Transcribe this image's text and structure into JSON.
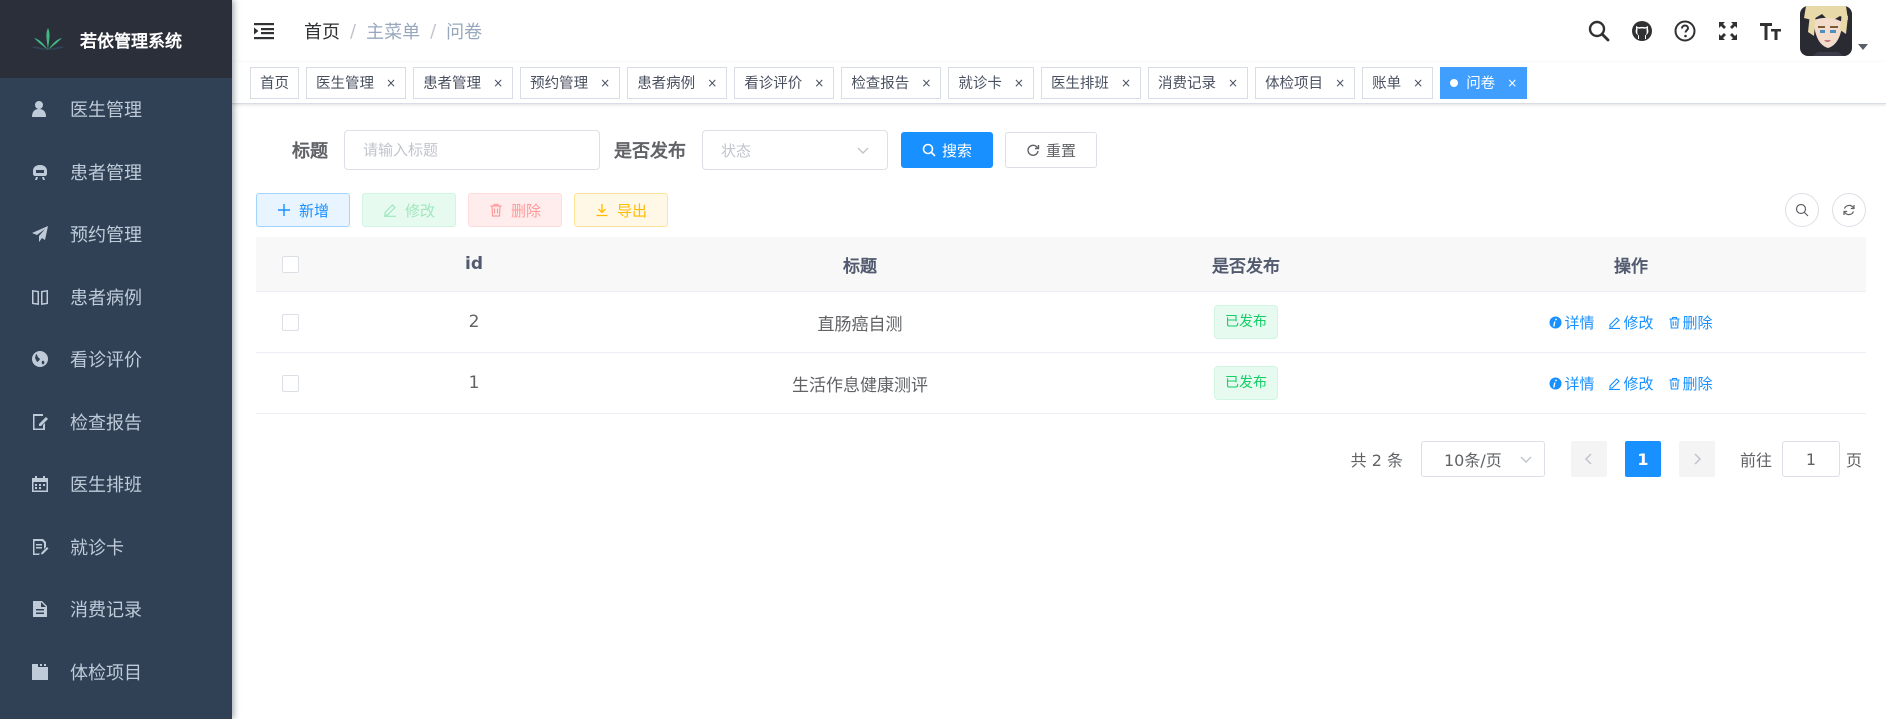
{
  "app": {
    "title": "若依管理系统"
  },
  "sidebar": {
    "items": [
      {
        "label": "医生管理",
        "icon": "doctor-icon"
      },
      {
        "label": "患者管理",
        "icon": "patient-icon"
      },
      {
        "label": "预约管理",
        "icon": "send-icon"
      },
      {
        "label": "患者病例",
        "icon": "book-icon"
      },
      {
        "label": "看诊评价",
        "icon": "globe-icon"
      },
      {
        "label": "检查报告",
        "icon": "edit-doc-icon"
      },
      {
        "label": "医生排班",
        "icon": "calendar-icon"
      },
      {
        "label": "就诊卡",
        "icon": "card-icon"
      },
      {
        "label": "消费记录",
        "icon": "receipt-icon"
      },
      {
        "label": "体检项目",
        "icon": "folder-icon"
      }
    ]
  },
  "breadcrumb": {
    "home": "首页",
    "menu": "主菜单",
    "current": "问卷",
    "separator": "/"
  },
  "tags": [
    {
      "label": "首页",
      "closable": false
    },
    {
      "label": "医生管理",
      "closable": true
    },
    {
      "label": "患者管理",
      "closable": true
    },
    {
      "label": "预约管理",
      "closable": true
    },
    {
      "label": "患者病例",
      "closable": true
    },
    {
      "label": "看诊评价",
      "closable": true
    },
    {
      "label": "检查报告",
      "closable": true
    },
    {
      "label": "就诊卡",
      "closable": true
    },
    {
      "label": "医生排班",
      "closable": true
    },
    {
      "label": "消费记录",
      "closable": true
    },
    {
      "label": "体检项目",
      "closable": true
    },
    {
      "label": "账单",
      "closable": true
    },
    {
      "label": "问卷",
      "closable": true,
      "active": true
    }
  ],
  "tag_close": "×",
  "search": {
    "title_label": "标题",
    "title_placeholder": "请输入标题",
    "title_value": "",
    "publish_label": "是否发布",
    "publish_placeholder": "状态",
    "search_button": "搜索",
    "reset_button": "重置"
  },
  "toolbar": {
    "add": "新增",
    "edit": "修改",
    "delete": "删除",
    "export": "导出"
  },
  "table": {
    "columns": [
      "id",
      "标题",
      "是否发布",
      "操作"
    ],
    "rows": [
      {
        "id": "2",
        "title": "直肠癌自测",
        "status": "已发布"
      },
      {
        "id": "1",
        "title": "生活作息健康测评",
        "status": "已发布"
      }
    ],
    "actions": {
      "detail": "详情",
      "edit": "修改",
      "delete": "删除"
    }
  },
  "pagination": {
    "total": "共 2 条",
    "page_size": "10条/页",
    "current": "1",
    "goto_label": "前往",
    "goto_value": "1",
    "page_suffix": "页"
  },
  "colors": {
    "primary": "#1890ff",
    "sidebar_bg": "#304156",
    "success": "#13ce66",
    "active_tag": "#409eff"
  }
}
